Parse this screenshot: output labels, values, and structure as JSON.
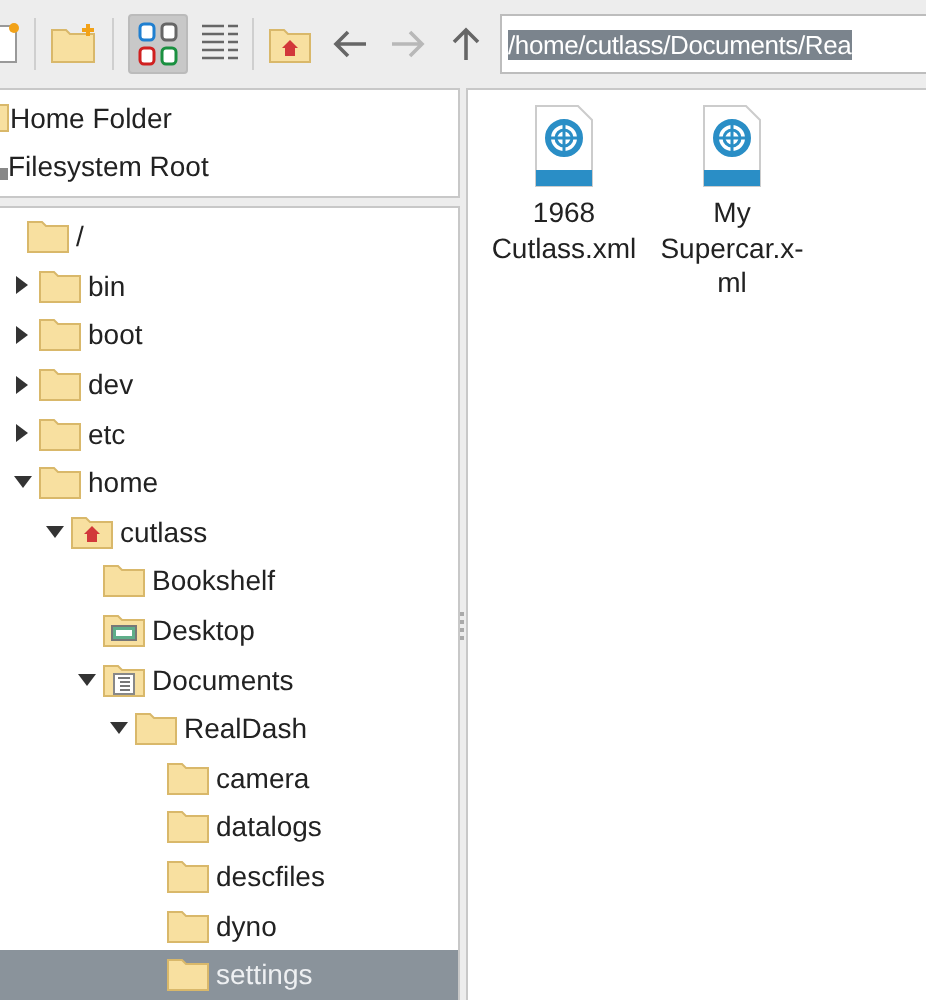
{
  "toolbar": {
    "view_modes": [
      {
        "kind": "icons",
        "selected": true
      },
      {
        "kind": "list",
        "selected": false
      }
    ],
    "navigation": [
      {
        "kind": "back",
        "disabled": false
      },
      {
        "kind": "forward",
        "disabled": true
      },
      {
        "kind": "up",
        "disabled": false
      }
    ],
    "path": {
      "value": "/home/cutlass/Documents/Rea",
      "selected": true
    }
  },
  "places": [
    {
      "label": "Home Folder",
      "kind": "home"
    },
    {
      "label": "Filesystem Root",
      "kind": "drive"
    }
  ],
  "tree": [
    {
      "label": "/",
      "kind": "folder",
      "selected": false,
      "children": [
        {
          "label": "bin",
          "kind": "folder",
          "expanded": false,
          "selected": false
        },
        {
          "label": "boot",
          "kind": "folder",
          "expanded": false,
          "selected": false
        },
        {
          "label": "dev",
          "kind": "folder",
          "expanded": false,
          "selected": false
        },
        {
          "label": "etc",
          "kind": "folder",
          "expanded": false,
          "selected": false
        },
        {
          "label": "home",
          "kind": "folder",
          "expanded": true,
          "selected": false,
          "children": [
            {
              "label": "cutlass",
              "kind": "home",
              "expanded": true,
              "selected": false,
              "children": [
                {
                  "label": "Bookshelf",
                  "kind": "folder",
                  "selected": false
                },
                {
                  "label": "Desktop",
                  "kind": "desktop",
                  "selected": false
                },
                {
                  "label": "Documents",
                  "kind": "documents",
                  "expanded": true,
                  "selected": false,
                  "children": [
                    {
                      "label": "RealDash",
                      "kind": "folder",
                      "expanded": true,
                      "selected": false,
                      "children": [
                        {
                          "label": "camera",
                          "kind": "folder",
                          "selected": false
                        },
                        {
                          "label": "datalogs",
                          "kind": "folder",
                          "selected": false
                        },
                        {
                          "label": "descfiles",
                          "kind": "folder",
                          "selected": false
                        },
                        {
                          "label": "dyno",
                          "kind": "folder",
                          "selected": false
                        },
                        {
                          "label": "settings",
                          "kind": "folder",
                          "selected": true
                        }
                      ]
                    }
                  ]
                }
              ]
            }
          ]
        }
      ]
    }
  ],
  "files": [
    {
      "label_lines": [
        "1968",
        "Cutlass.xml"
      ]
    },
    {
      "label_lines": [
        "My",
        "Supercar.x-",
        "ml"
      ]
    }
  ]
}
